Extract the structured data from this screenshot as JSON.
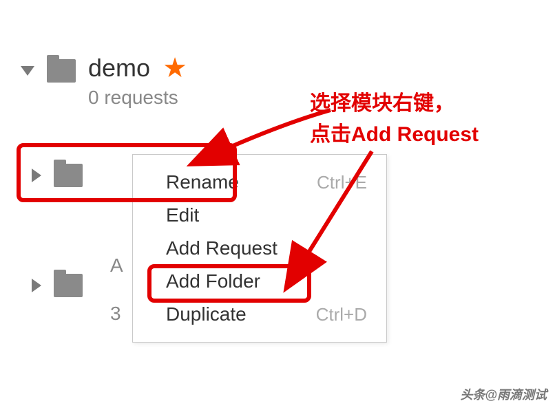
{
  "collection": {
    "name": "demo",
    "subtitle": "0 requests",
    "starred": true
  },
  "folders": {
    "item_a_label": "A",
    "item_sub": "3"
  },
  "contextMenu": {
    "items": [
      {
        "label": "Rename",
        "shortcut": "Ctrl+E"
      },
      {
        "label": "Edit",
        "shortcut": ""
      },
      {
        "label": "Add Request",
        "shortcut": ""
      },
      {
        "label": "Add Folder",
        "shortcut": ""
      },
      {
        "label": "Duplicate",
        "shortcut": "Ctrl+D"
      }
    ]
  },
  "annotation": {
    "line1": "选择模块右键，",
    "line2": "点击Add Request"
  },
  "watermark": "头条@雨滴测试"
}
